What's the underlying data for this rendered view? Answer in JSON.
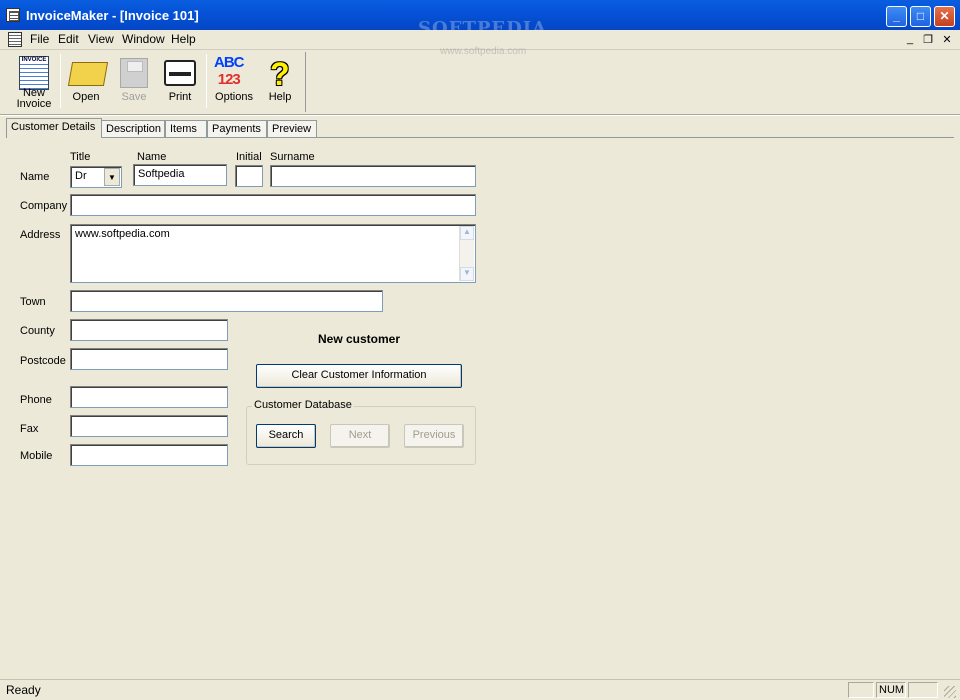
{
  "window": {
    "title": "InvoiceMaker - [Invoice 101]"
  },
  "watermark": {
    "main": "SOFTPEDIA",
    "sub": "www.softpedia.com"
  },
  "menu": [
    "File",
    "Edit",
    "View",
    "Window",
    "Help"
  ],
  "toolbar": {
    "new_invoice": "New Invoice",
    "open": "Open",
    "save": "Save",
    "print": "Print",
    "options": "Options",
    "help": "Help",
    "new_invoice_line1": "New",
    "new_invoice_line2": "Invoice",
    "options_icon_top": "ABC",
    "options_icon_bottom": "123"
  },
  "tabs": [
    "Customer Details",
    "Description",
    "Items",
    "Payments",
    "Preview"
  ],
  "form": {
    "name_row_label": "Name",
    "title_header": "Title",
    "name_header": "Name",
    "initial_header": "Initial",
    "surname_header": "Surname",
    "title_value": "Dr",
    "name_value": "Softpedia",
    "initial_value": "",
    "surname_value": "",
    "company_label": "Company",
    "company_value": "",
    "address_label": "Address",
    "address_value": "www.softpedia.com",
    "town_label": "Town",
    "town_value": "",
    "county_label": "County",
    "county_value": "",
    "postcode_label": "Postcode",
    "postcode_value": "",
    "phone_label": "Phone",
    "phone_value": "",
    "fax_label": "Fax",
    "fax_value": "",
    "mobile_label": "Mobile",
    "mobile_value": ""
  },
  "customer": {
    "status": "New customer",
    "clear_button": "Clear Customer Information",
    "database_title": "Customer Database",
    "search_button": "Search",
    "next_button": "Next",
    "previous_button": "Previous"
  },
  "status": {
    "text": "Ready",
    "num": "NUM"
  }
}
